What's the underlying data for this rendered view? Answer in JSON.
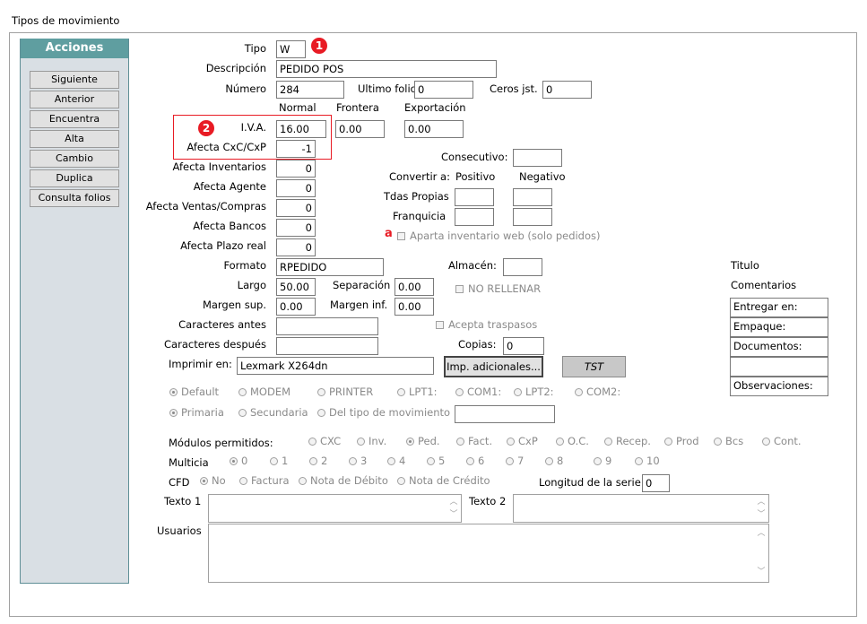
{
  "window": {
    "title": "Tipos de movimiento"
  },
  "sidebar": {
    "header": "Acciones",
    "buttons": [
      "Siguiente",
      "Anterior",
      "Encuentra",
      "Alta",
      "Cambio",
      "Duplica",
      "Consulta folios"
    ]
  },
  "badges": {
    "one": "1",
    "two": "2",
    "a": "a"
  },
  "form": {
    "tipo": {
      "label": "Tipo",
      "value": "W"
    },
    "descripcion": {
      "label": "Descripción",
      "value": "PEDIDO POS"
    },
    "numero": {
      "label": "Número",
      "value": "284"
    },
    "ultimo_folio": {
      "label": "Ultimo folio",
      "value": "0"
    },
    "ceros_jst": {
      "label": "Ceros jst.",
      "value": "0"
    },
    "col_headers": {
      "normal": "Normal",
      "frontera": "Frontera",
      "exportacion": "Exportación"
    },
    "iva": {
      "label": "I.V.A.",
      "normal": "16.00",
      "frontera": "0.00",
      "exportacion": "0.00"
    },
    "afecta_cxc": {
      "label": "Afecta  CxC/CxP",
      "value": "-1"
    },
    "afecta_inventarios": {
      "label": "Afecta  Inventarios",
      "value": "0"
    },
    "afecta_agente": {
      "label": "Afecta  Agente",
      "value": "0"
    },
    "afecta_ventas": {
      "label": "Afecta  Ventas/Compras",
      "value": "0"
    },
    "afecta_bancos": {
      "label": "Afecta  Bancos",
      "value": "0"
    },
    "afecta_plazo": {
      "label": "Afecta  Plazo real",
      "value": "0"
    },
    "consecutivo": {
      "label": "Consecutivo:",
      "value": ""
    },
    "convertir": {
      "label": "Convertir a:",
      "positivo": "Positivo",
      "negativo": "Negativo"
    },
    "tdas_propias": {
      "label": "Tdas Propias"
    },
    "franquicia": {
      "label": "Franquicia"
    },
    "aparta": {
      "label": "Aparta inventario web (solo pedidos)"
    },
    "formato": {
      "label": "Formato",
      "value": "RPEDIDO"
    },
    "almacen": {
      "label": "Almacén:",
      "value": ""
    },
    "largo": {
      "label": "Largo",
      "value": "50.00"
    },
    "separacion": {
      "label": "Separación",
      "value": "0.00"
    },
    "no_rellenar": {
      "label": "NO RELLENAR"
    },
    "margen_sup": {
      "label": "Margen sup.",
      "value": "0.00"
    },
    "margen_inf": {
      "label": "Margen inf.",
      "value": "0.00"
    },
    "caracteres_antes": {
      "label": "Caracteres antes",
      "value": ""
    },
    "acepta_traspasos": {
      "label": "Acepta traspasos"
    },
    "caracteres_despues": {
      "label": "Caracteres después",
      "value": ""
    },
    "copias": {
      "label": "Copias:",
      "value": "0"
    },
    "imprimir_en": {
      "label": "Imprimir en:",
      "value": "Lexmark X264dn"
    },
    "imp_adicionales": "Imp. adicionales...",
    "tst": "TST",
    "ports": [
      "Default",
      "MODEM",
      "PRINTER",
      "LPT1:",
      "COM1:",
      "LPT2:",
      "COM2:"
    ],
    "bin": [
      "Primaria",
      "Secundaria",
      "Del tipo de movimiento"
    ],
    "modulos": {
      "label": "Módulos permitidos:",
      "items": [
        "CXC",
        "Inv.",
        "Ped.",
        "Fact.",
        "CxP",
        "O.C.",
        "Recep.",
        "Prod",
        "Bcs",
        "Cont."
      ]
    },
    "multicia": {
      "label": "Multicia",
      "items": [
        "0",
        "1",
        "2",
        "3",
        "4",
        "5",
        "6",
        "7",
        "8",
        "9",
        "10"
      ]
    },
    "cfd": {
      "label": "CFD",
      "items": [
        "No",
        "Factura",
        "Nota de Débito",
        "Nota de Crédito"
      ]
    },
    "longitud_serie": {
      "label": "Longitud de la serie",
      "value": "0"
    },
    "texto1": {
      "label": "Texto 1"
    },
    "texto2": {
      "label": "Texto 2"
    },
    "usuarios": {
      "label": "Usuarios"
    },
    "right_panel": {
      "titulo": "Titulo",
      "comentarios": "Comentarios",
      "fields": [
        "Entregar en:",
        "Empaque:",
        "Documentos:",
        "",
        "Observaciones:"
      ]
    }
  }
}
